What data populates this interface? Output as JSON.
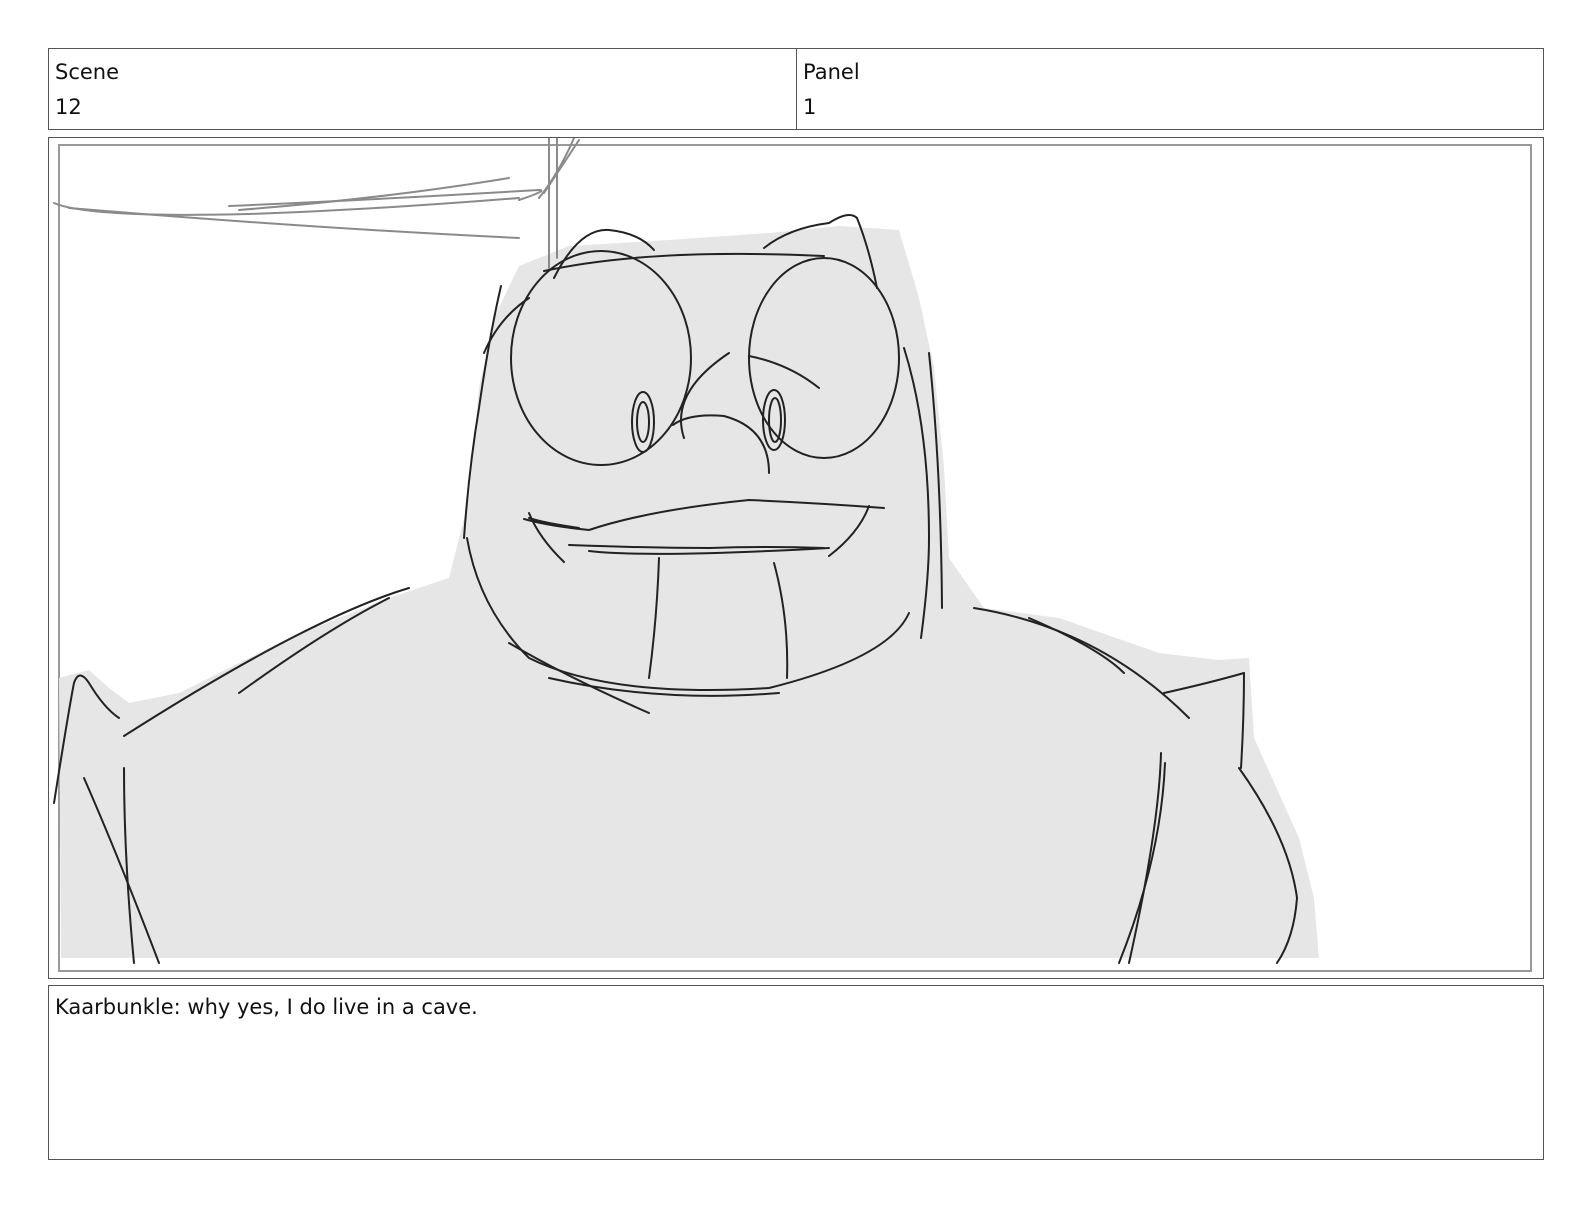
{
  "header": {
    "scene_label": "Scene",
    "scene_value": "12",
    "panel_label": "Panel",
    "panel_value": "1"
  },
  "caption": {
    "text": "Kaarbunkle: why yes, I do live in a cave."
  },
  "colors": {
    "border": "#555555",
    "sketch_fill": "#e6e6e6",
    "sketch_line": "#222222",
    "frame_line": "#999999"
  },
  "drawing": {
    "subject": "storyboard-sketch-character-icon"
  }
}
